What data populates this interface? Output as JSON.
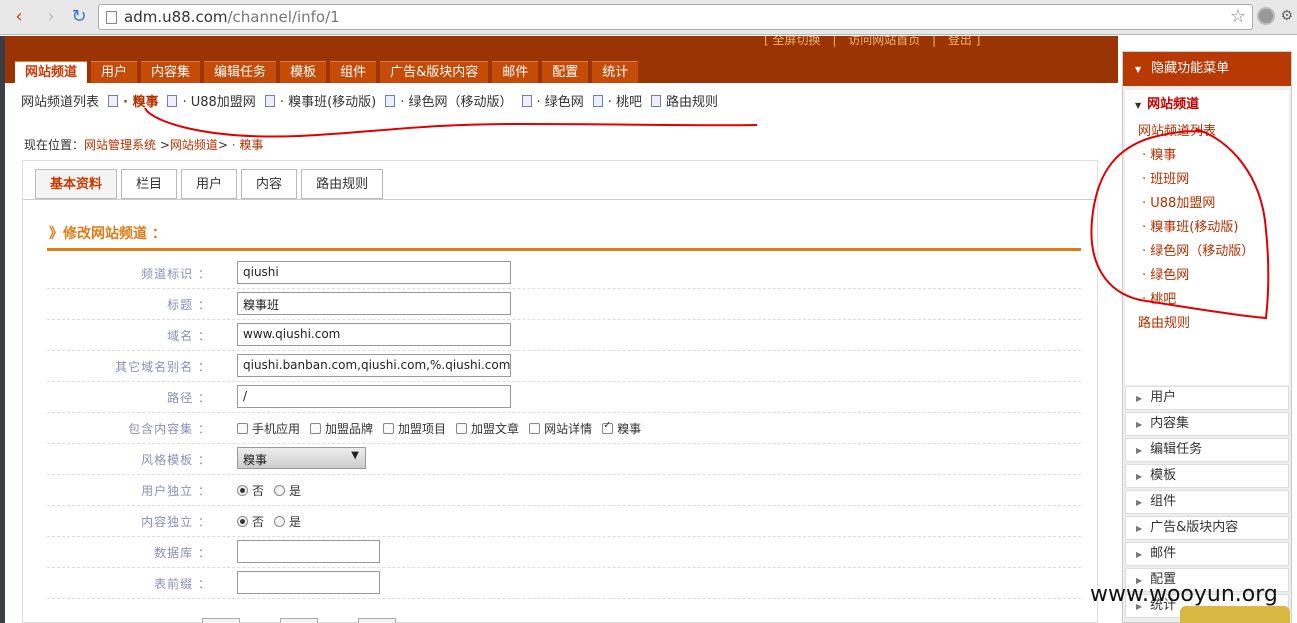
{
  "browser": {
    "url_host": "adm.u88.com",
    "url_path": "/channel/info/1"
  },
  "header": {
    "top_links": [
      "[ 全屏切换",
      "|",
      "访问网站首页",
      "|",
      "登出 ]"
    ],
    "tabs": [
      "网站频道",
      "用户",
      "内容集",
      "编辑任务",
      "模板",
      "组件",
      "广告&版块内容",
      "邮件",
      "配置",
      "统计"
    ]
  },
  "subnav": {
    "items": [
      "网站频道列表",
      "· 糗事",
      "· U88加盟网",
      "· 糗事班(移动版)",
      "· 绿色网（移动版）",
      "· 绿色网",
      "· 桃吧",
      "路由规则"
    ]
  },
  "breadcrumb": {
    "prefix": "现在位置：",
    "link1": "网站管理系统",
    "sep1": " >",
    "link2": "网站频道",
    "sep2": "> ",
    "current": "· 糗事"
  },
  "panel_tabs": [
    "基本资料",
    "栏目",
    "用户",
    "内容",
    "路由规则"
  ],
  "section_title": "》修改网站频道 ：",
  "form": {
    "channel_id": {
      "label": "频道标识 ：",
      "value": "qiushi"
    },
    "title": {
      "label": "标题 ：",
      "value": "糗事班"
    },
    "domain": {
      "label": "域名 ：",
      "value": "www.qiushi.com"
    },
    "alias": {
      "label": "其它域名别名 ：",
      "value": "qiushi.banban.com,qiushi.com,%.qiushi.com"
    },
    "path": {
      "label": "路径 ：",
      "value": "/"
    },
    "contents": {
      "label": "包含内容集 ：",
      "options": [
        "手机应用",
        "加盟品牌",
        "加盟项目",
        "加盟文章",
        "网站详情",
        "糗事"
      ],
      "checked": [
        false,
        false,
        false,
        false,
        false,
        true
      ]
    },
    "style": {
      "label": "风格模板 ：",
      "value": "糗事"
    },
    "user_independent": {
      "label": "用户独立 ：",
      "options": [
        "否",
        "是"
      ],
      "selected": 0
    },
    "content_independent": {
      "label": "内容独立 ：",
      "options": [
        "否",
        "是"
      ],
      "selected": 0
    },
    "database": {
      "label": "数据库 ：",
      "value": ""
    },
    "table_prefix": {
      "label": "表前缀 ：",
      "value": ""
    }
  },
  "sidebar": {
    "header": "隐藏功能菜单",
    "group": "网站频道",
    "links": [
      "网站频道列表",
      "· 糗事",
      "· 班班网",
      "· U88加盟网",
      "· 糗事班(移动版)",
      "· 绿色网（移动版）",
      "· 绿色网",
      "· 桃吧",
      "路由规则"
    ],
    "items": [
      "用户",
      "内容集",
      "编辑任务",
      "模板",
      "组件",
      "广告&版块内容",
      "邮件",
      "配置",
      "统计"
    ]
  },
  "watermark": "www.wooyun.org",
  "colors": {
    "brand": "#9a3404",
    "tab": "#c44b08",
    "accent": "#e07b1a",
    "link": "#b53000",
    "annotation": "#e00000"
  }
}
